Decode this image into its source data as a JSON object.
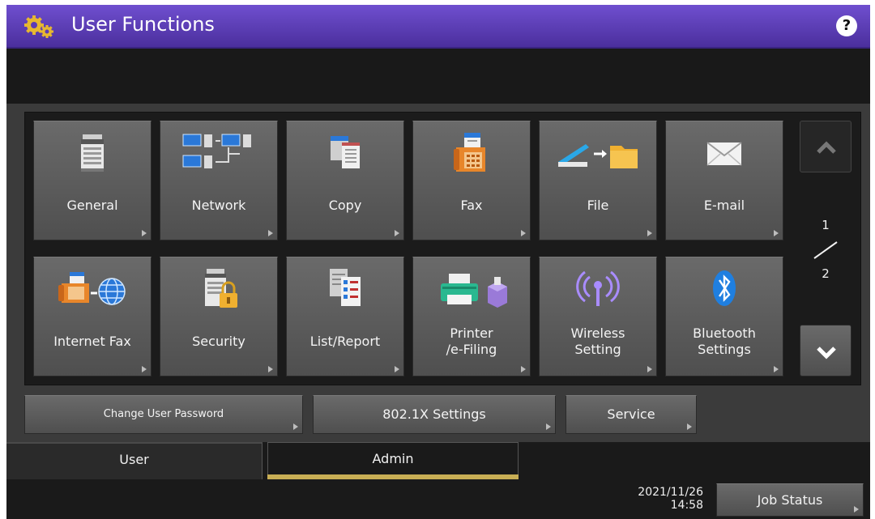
{
  "header": {
    "title": "User Functions",
    "title_icon": "gears-icon",
    "help_label": "?"
  },
  "tiles": [
    {
      "label": "General",
      "icon": "copier-icon"
    },
    {
      "label": "Network",
      "icon": "network-icon"
    },
    {
      "label": "Copy",
      "icon": "copy-documents-icon"
    },
    {
      "label": "Fax",
      "icon": "fax-icon"
    },
    {
      "label": "File",
      "icon": "scan-to-folder-icon"
    },
    {
      "label": "E-mail",
      "icon": "envelope-icon"
    },
    {
      "label": "Internet Fax",
      "icon": "internet-fax-icon"
    },
    {
      "label": "Security",
      "icon": "copier-lock-icon"
    },
    {
      "label": "List/Report",
      "icon": "list-report-icon"
    },
    {
      "label": "Printer\n/e-Filing",
      "icon": "printer-efiling-icon"
    },
    {
      "label": "Wireless\nSetting",
      "icon": "wireless-icon"
    },
    {
      "label": "Bluetooth\nSettings",
      "icon": "bluetooth-icon"
    }
  ],
  "pager": {
    "current": "1",
    "total": "2"
  },
  "buttons": {
    "change_password": "Change User Password",
    "dot1x": "802.1X Settings",
    "service": "Service"
  },
  "tabs": {
    "user": "User",
    "admin": "Admin",
    "active": "Admin"
  },
  "status": {
    "date": "2021/11/26",
    "time": "14:58",
    "job_status": "Job Status"
  },
  "colors": {
    "title_bar": "#5a3cb8",
    "tab_indicator": "#c8ae55",
    "bluetooth": "#1f7fe0"
  }
}
